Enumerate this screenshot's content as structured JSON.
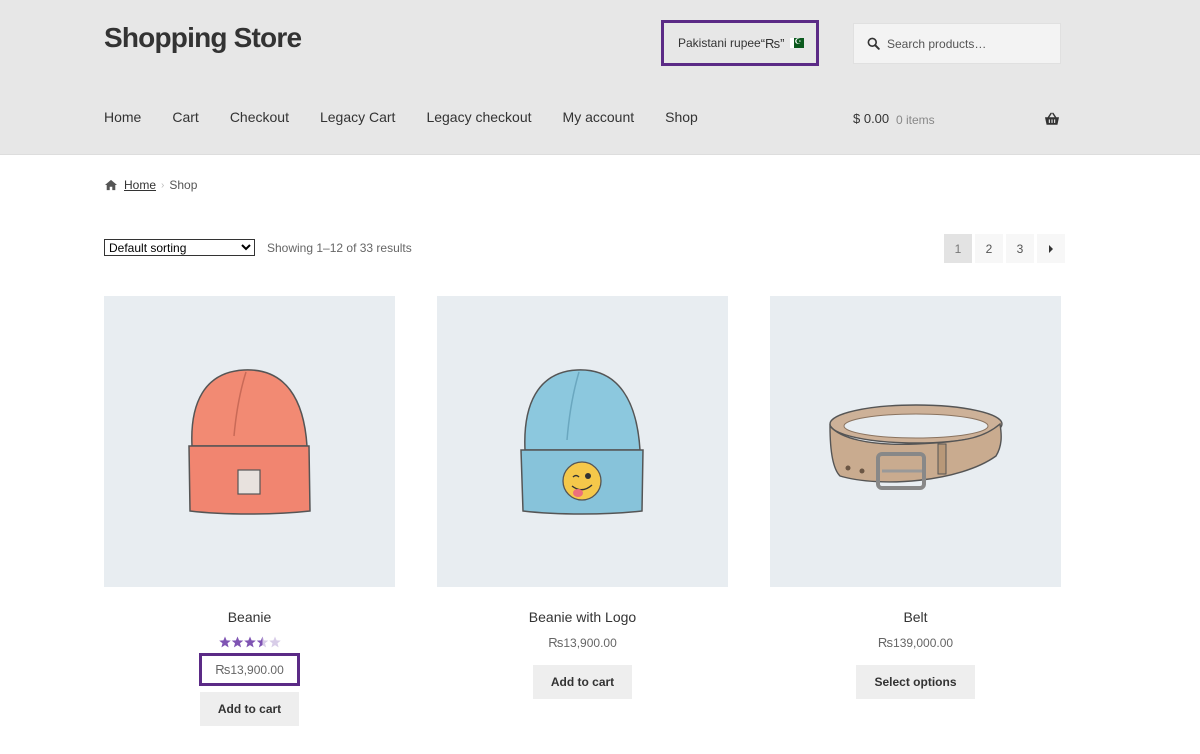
{
  "header": {
    "site_title": "Shopping Store",
    "currency": {
      "label": "Pakistani rupee",
      "symbol": "“₨”",
      "flag_icon": "pakistan-flag-icon"
    },
    "search_placeholder": "Search products…",
    "background": "#e7e7e7"
  },
  "nav": {
    "items": [
      {
        "label": "Home"
      },
      {
        "label": "Cart"
      },
      {
        "label": "Checkout"
      },
      {
        "label": "Legacy Cart"
      },
      {
        "label": "Legacy checkout"
      },
      {
        "label": "My account"
      },
      {
        "label": "Shop"
      }
    ]
  },
  "cart": {
    "total": "$ 0.00",
    "count": "0 items",
    "icon": "basket-icon"
  },
  "breadcrumb": {
    "home": "Home",
    "current": "Shop"
  },
  "toolbar": {
    "sort_selected": "Default sorting",
    "sort_options": [
      "Default sorting"
    ],
    "result_count": "Showing 1–12 of 33 results"
  },
  "pagination": {
    "pages": [
      "1",
      "2",
      "3"
    ],
    "current": "1",
    "next_icon": "next-arrow-icon"
  },
  "products": [
    {
      "name": "Beanie",
      "rating": 3.5,
      "rating_max": 5,
      "currency_symbol": "₨",
      "price": "13,900.00",
      "button": "Add to cart",
      "image": "red-beanie"
    },
    {
      "name": "Beanie with Logo",
      "currency_symbol": "₨",
      "price": "13,900.00",
      "button": "Add to cart",
      "image": "blue-beanie-with-emoji"
    },
    {
      "name": "Belt",
      "currency_symbol": "₨",
      "price": "139,000.00",
      "button": "Select options",
      "image": "leather-belt"
    }
  ],
  "colors": {
    "highlight": "#5b2a86",
    "star": "#7f54b3",
    "image_bg": "#e8edf1"
  }
}
